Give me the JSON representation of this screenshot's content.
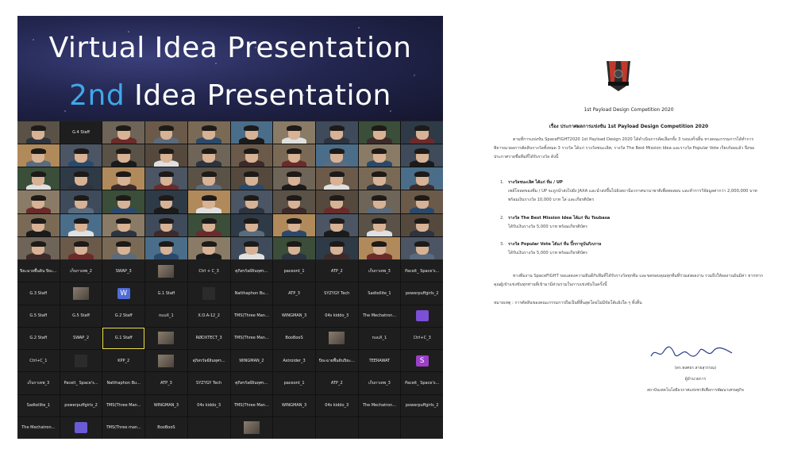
{
  "banner": {
    "line1": "Virtual Idea Presentation",
    "line2_accent": "2nd",
    "line2_rest": " Idea Presentation"
  },
  "video_labels": [
    "G.4 Staff"
  ],
  "name_tiles": [
    {
      "label": "ปิยะฉายพื้นดิน ปิยะ..."
    },
    {
      "label": "เก็บกาเทพ_2"
    },
    {
      "label": "SWAP_3"
    },
    {
      "thumb": true
    },
    {
      "label": "Ctrl + C_3"
    },
    {
      "label": "ศุภิสรรัลย์อินทุศร..."
    },
    {
      "label": "paceont_1"
    },
    {
      "label": "ATP_2"
    },
    {
      "label": "เก็บกาเทพ_3"
    },
    {
      "label": "Paceit_ Space's..."
    },
    {
      "label": "G.3 Staff"
    },
    {
      "thumb": true
    },
    {
      "avatar": "W",
      "color": "#4f6cd6"
    },
    {
      "label": "G.1 Staff"
    },
    {
      "dark": true
    },
    {
      "label": "Natthaphon Bu..."
    },
    {
      "label": "ATP_3"
    },
    {
      "label": "SYZYGY Tech"
    },
    {
      "label": "Sadtellite_1"
    },
    {
      "label": "powerpuffgirls_2"
    },
    {
      "label": "G.5 Staff"
    },
    {
      "label": "G.5 Staff"
    },
    {
      "label": "G.2 Staff"
    },
    {
      "label": "nuuX_1"
    },
    {
      "label": "X.Ö.A-12_2"
    },
    {
      "label": "TMS(Three Man..."
    },
    {
      "label": "WINGMAN_3"
    },
    {
      "label": "04s kiddo_3"
    },
    {
      "label": "The Mechatron..."
    },
    {
      "avatar": "",
      "color": "#7b4fd6"
    },
    {
      "label": "G.2 Staff"
    },
    {
      "label": "SWAP_2"
    },
    {
      "label": "G.1 Staff",
      "active": true
    },
    {
      "thumb": true
    },
    {
      "label": "RØDXTECT_3"
    },
    {
      "label": "TMS(Three Man..."
    },
    {
      "label": "BooBooS"
    },
    {
      "thumb": true
    },
    {
      "label": "nuuX_1"
    },
    {
      "label": "Ctrl+C_3"
    },
    {
      "label": "Ctrl+C_1"
    },
    {
      "dark": true
    },
    {
      "label": "KPP_2"
    },
    {
      "thumb": true
    },
    {
      "label": "ศุภิสรรัลย์อินทุศร..."
    },
    {
      "label": "WINGMAN_2"
    },
    {
      "label": "Astroider_3"
    },
    {
      "label": "ปิยะฉายพื้นดินปิยะ..."
    },
    {
      "label": "TEERAWAT"
    },
    {
      "avatar": "S",
      "color": "#9b3fc8"
    },
    {
      "label": "เก็บกาเทพ_3"
    },
    {
      "label": "Paceit_ Space's..."
    },
    {
      "label": "Natthaphon Bu..."
    },
    {
      "label": "ATP_3"
    },
    {
      "label": "SYZYGY Tech"
    },
    {
      "label": "ศุภิสรรัลย์อินทุศร..."
    },
    {
      "label": "paceont_1"
    },
    {
      "label": "ATP_2"
    },
    {
      "label": "เก็บกาเทพ_3"
    },
    {
      "label": "Paceit_ Space's..."
    },
    {
      "label": "Sadtellite_1"
    },
    {
      "label": "powerpuffgirls_2"
    },
    {
      "label": "TMS(Three Man..."
    },
    {
      "label": "WINGMAN_3"
    },
    {
      "label": "04s kiddo_3"
    },
    {
      "label": "TMS(Three Man..."
    },
    {
      "label": "WINGMAN_3"
    },
    {
      "label": "04s kiddo_3"
    },
    {
      "label": "The Mechatron..."
    },
    {
      "label": "powerpuffgirls_2"
    },
    {
      "label": "The Mechatron..."
    },
    {
      "avatar": "",
      "color": "#6a5ad6"
    },
    {
      "label": "TMS(Three man..."
    },
    {
      "label": "BooBooS"
    },
    {
      "label": ""
    },
    {
      "thumb": true
    },
    {
      "label": ""
    },
    {
      "label": ""
    },
    {
      "label": ""
    },
    {
      "label": ""
    }
  ],
  "document": {
    "heading": "1st Payload Design Competition 2020",
    "subject": "เรื่อง ประกาศผลการแข่งขัน 1st Payload Design Competition 2020",
    "para1": "ตามที่การแข่งขัน SpaceFIGHT2020 1st Payload Design 2020 ได้ดำเนินการคัดเลือกทั้ง 3 รอบเสร็จสิ้น ทางคณะกรรมการได้ทำการพิจารณาผลการตัดสินรางวัลทั้งหมด 3 รางวัล ได้แก่ รางวัลชนะเลิศ, รางวัล The Best Mission Idea และรางวัล Popular Vote เรียบร้อยแล้ว จึงขอประกาศรายชื่อทีมที่ได้รับรางวัล ดังนี้",
    "item1_title": "รางวัลชนะเลิศ ได้แก่ ทีม / UP",
    "item1_body": "เพย์โหลดของทีม / UP จะถูกนำส่งไปยัง JAXA และนำส่งขึ้นไปยังสถานีอวกาศนานาชาติเพื่อทดสอบ และทำการวิจัยมูลค่ากว่า 2,000,000 บาท พร้อมเงินรางวัล 10,000 บาท โล่ และเกียรติบัตร",
    "item2_title": "รางวัล The Best Mission Idea ได้แก่ ทีม Tsubasa",
    "item2_body": "ได้รับเงินรางวัล 5,000 บาท พร้อมเกียรติบัตร",
    "item3_title": "รางวัล Popular Vote ได้แก่ ทีม ปิ๊กกาจูบันกิภภาษ",
    "item3_body": "ได้รับเงินรางวัล 5,000 บาท พร้อมเกียรติบัตร",
    "para2": "ทางทีมงาน SpaceFIGHT ขอแสดงความยินดีกับทีมที่ได้รับรางวัลทุกทีม และขอขอบคุณทุกทีมที่ร่วมส่งผลงาน รวมถึงให้ผลงานอันมีค่า หากหากคุณผู้เข้าแข่งขันทุกท่านที่เข้ามามีส่วนร่วมในการแข่งขันในครั้งนี้",
    "note": "หมายเหตุ : การตัดสินของคณะกรรมการถือเป็นที่สิ้นสุดโดยไม่มีข้อโต้แย้งใด ๆ ทั้งสิ้น",
    "signer_name": "(ดร.พงศธร สายสุวรรณ)",
    "signer_title": "ผู้อำนวยการ",
    "signer_org": "สถาบันเทคโนโลยีอวกาศแห่งชาติเพื่อการพัฒนาเศรษฐกิจ"
  }
}
